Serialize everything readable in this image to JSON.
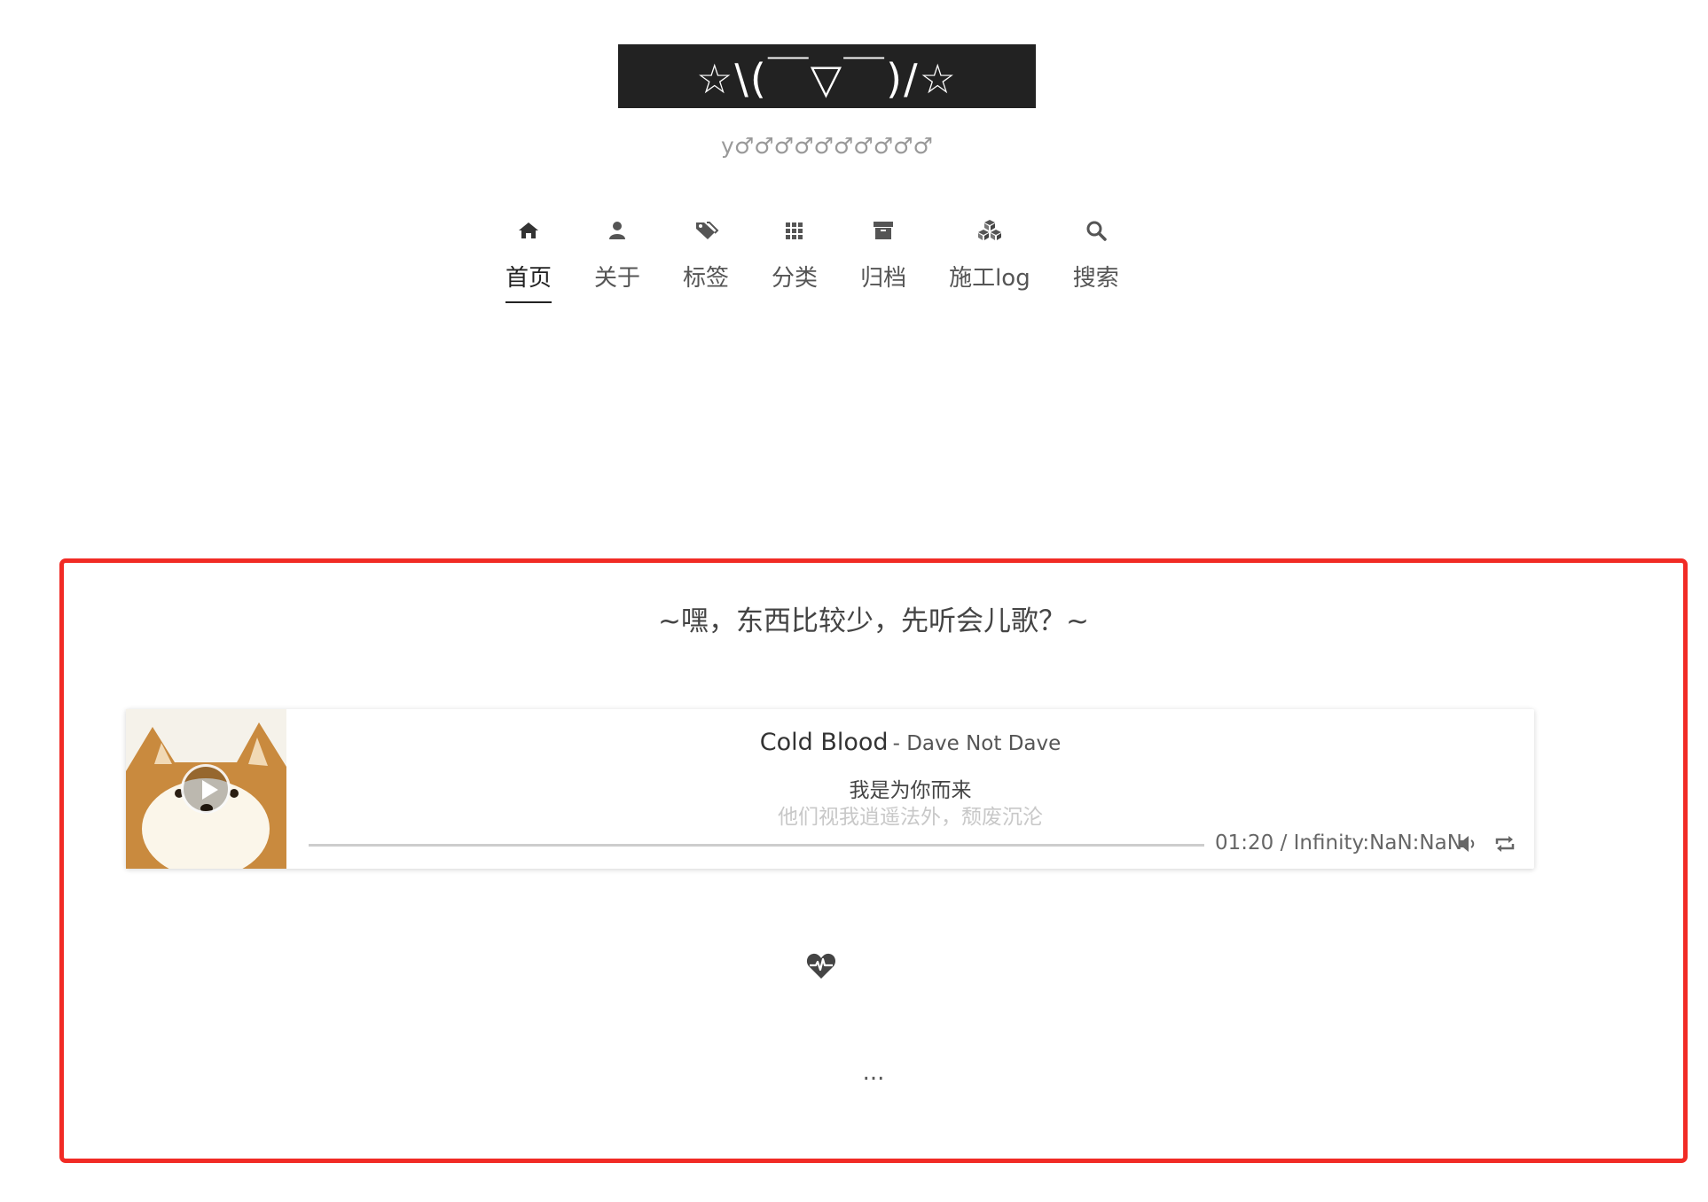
{
  "site": {
    "title": "☆\\(￣▽￣)/☆",
    "subtitle": "y♂♂♂♂♂♂♂♂♂♂"
  },
  "nav": {
    "items": [
      {
        "label": "首页",
        "icon": "home-icon",
        "active": true
      },
      {
        "label": "关于",
        "icon": "user-icon"
      },
      {
        "label": "标签",
        "icon": "tags-icon"
      },
      {
        "label": "分类",
        "icon": "grid-icon"
      },
      {
        "label": "归档",
        "icon": "archive-icon"
      },
      {
        "label": "施工log",
        "icon": "cubes-icon"
      },
      {
        "label": "搜索",
        "icon": "search-icon"
      }
    ]
  },
  "main": {
    "heading": "~嘿，东西比较少，先听会儿歌？~",
    "player": {
      "song_title": "Cold Blood",
      "artist": " - Dave Not Dave",
      "lyric_current": "我是为你而来",
      "lyric_next": "他们视我逍遥法外，颓废沉沦",
      "time": "01:20 / Infinity:NaN:NaN",
      "progress": 0
    },
    "more": "..."
  },
  "colors": {
    "title_bg": "#222222",
    "highlight_border": "#f12b25",
    "text": "#555555"
  }
}
